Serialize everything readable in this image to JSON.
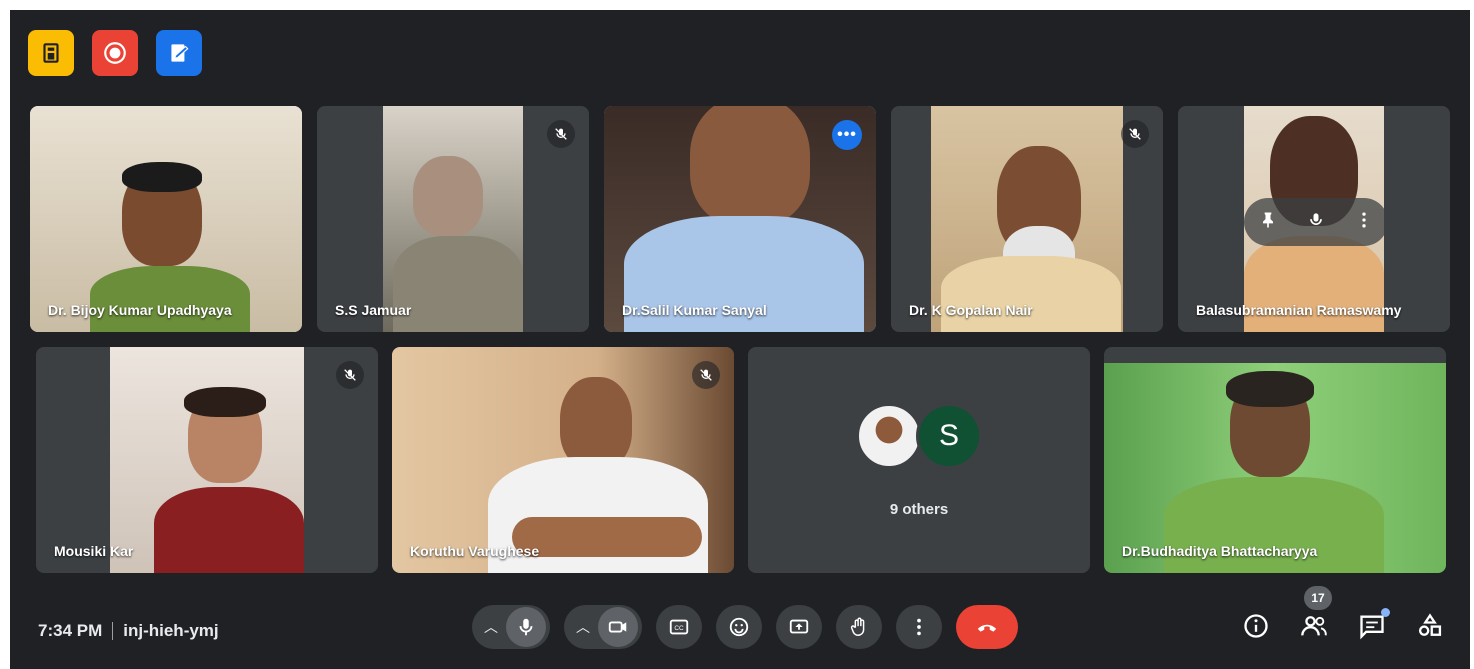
{
  "top_icons": [
    {
      "name": "meeting-details-icon",
      "color": "#fbbc04"
    },
    {
      "name": "recording-icon",
      "color": "#ea4335"
    },
    {
      "name": "whiteboard-icon",
      "color": "#1a73e8"
    }
  ],
  "participants": [
    {
      "name": "Dr. Bijoy Kumar Upadhyaya",
      "muted": false
    },
    {
      "name": "S.S Jamuar",
      "muted": true
    },
    {
      "name": "Dr.Salil Kumar Sanyal",
      "muted": false,
      "active_speaker": true,
      "more_options": "•••"
    },
    {
      "name": "Dr. K Gopalan Nair",
      "muted": true
    },
    {
      "name": "Balasubramanian Ramaswamy",
      "muted": false,
      "hover_controls": [
        "pin-icon",
        "mute-icon",
        "more-vert-icon"
      ]
    },
    {
      "name": "Mousiki Kar",
      "muted": true
    },
    {
      "name": "Koruthu Varughese",
      "muted": true
    },
    {
      "name": "Dr.Budhaditya Bhattacharyya",
      "muted": false
    }
  ],
  "others_tile": {
    "avatar_letter": "S",
    "label": "9 others"
  },
  "bottom_bar": {
    "time": "7:34 PM",
    "meeting_code": "inj-hieh-ymj",
    "participant_count": "17",
    "controls": [
      "mic-icon",
      "camera-icon",
      "captions-icon",
      "emoji-icon",
      "present-icon",
      "raise-hand-icon",
      "more-options-icon",
      "hang-up-icon"
    ],
    "right_controls": [
      "info-icon",
      "people-icon",
      "chat-icon",
      "activities-icon"
    ]
  },
  "colors": {
    "background": "#202124",
    "tile": "#3c4043",
    "active_outline": "#8ab4f8",
    "hang_up": "#ea4335"
  }
}
